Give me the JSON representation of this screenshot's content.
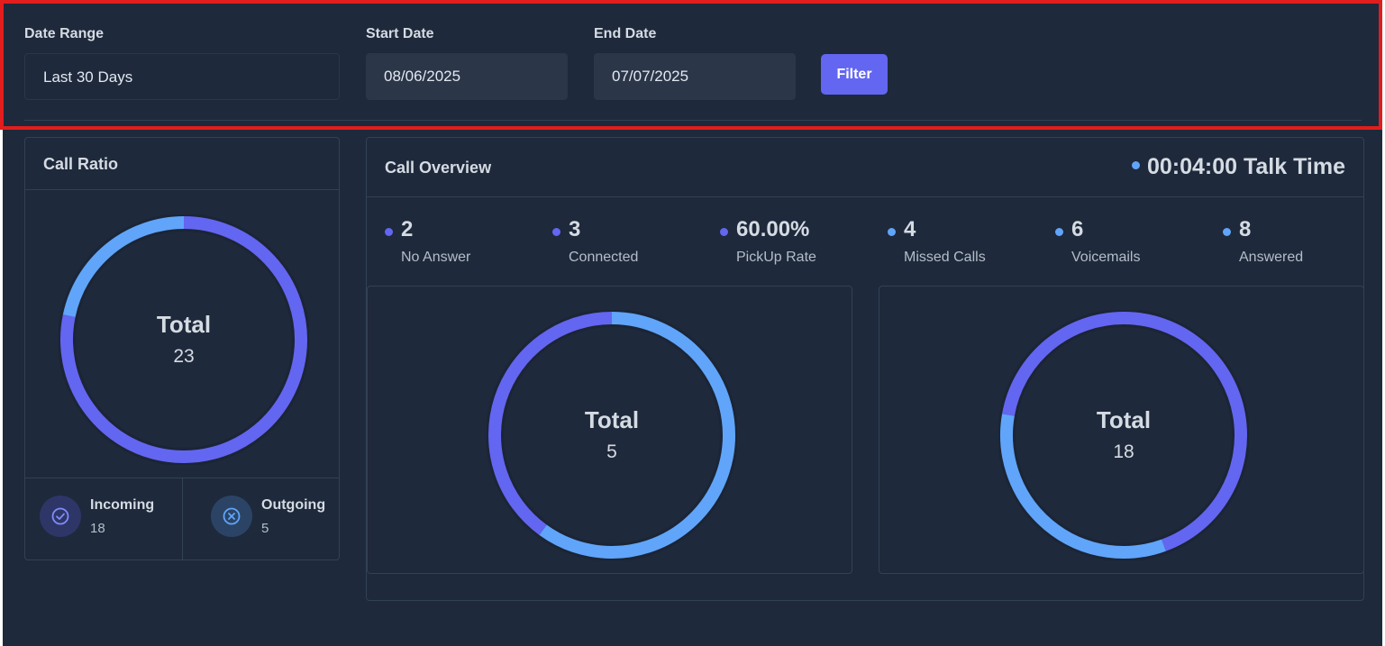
{
  "filters": {
    "date_range_label": "Date Range",
    "date_range_value": "Last 30 Days",
    "start_date_label": "Start Date",
    "start_date_value": "08/06/2025",
    "end_date_label": "End Date",
    "end_date_value": "07/07/2025",
    "filter_button": "Filter"
  },
  "call_ratio": {
    "title": "Call Ratio",
    "total_label": "Total",
    "total_value": "23",
    "incoming_label": "Incoming",
    "incoming_value": "18",
    "outgoing_label": "Outgoing",
    "outgoing_value": "5",
    "incoming_icon": "check-circle-icon",
    "outgoing_icon": "x-circle-icon"
  },
  "call_overview": {
    "title": "Call Overview",
    "talk_time": "00:04:00 Talk Time",
    "stats": [
      {
        "value": "2",
        "label": "No Answer",
        "color": "#6366f1"
      },
      {
        "value": "3",
        "label": "Connected",
        "color": "#6366f1"
      },
      {
        "value": "60.00%",
        "label": "PickUp Rate",
        "color": "#6366f1"
      },
      {
        "value": "4",
        "label": "Missed Calls",
        "color": "#60a5fa"
      },
      {
        "value": "6",
        "label": "Voicemails",
        "color": "#60a5fa"
      },
      {
        "value": "8",
        "label": "Answered",
        "color": "#60a5fa"
      }
    ],
    "donut_left": {
      "total_label": "Total",
      "total_value": "5"
    },
    "donut_right": {
      "total_label": "Total",
      "total_value": "18"
    }
  },
  "chart_data": [
    {
      "type": "pie",
      "title": "",
      "categories": [
        "Incoming",
        "Outgoing"
      ],
      "values": [
        18,
        5
      ],
      "colors": [
        "#6366f1",
        "#60a5fa"
      ]
    },
    {
      "type": "pie",
      "title": "",
      "categories": [
        "Connected",
        "No Answer"
      ],
      "values": [
        3,
        2
      ],
      "colors": [
        "#60a5fa",
        "#6366f1"
      ]
    },
    {
      "type": "pie",
      "title": "",
      "categories": [
        "Answered",
        "Voicemails",
        "Missed Calls"
      ],
      "values": [
        8,
        6,
        4
      ],
      "colors": [
        "#6366f1",
        "#60a5fa",
        "#6366f1"
      ]
    }
  ],
  "colors": {
    "indigo": "#6366f1",
    "blue": "#60a5fa",
    "background": "#1e293b"
  }
}
